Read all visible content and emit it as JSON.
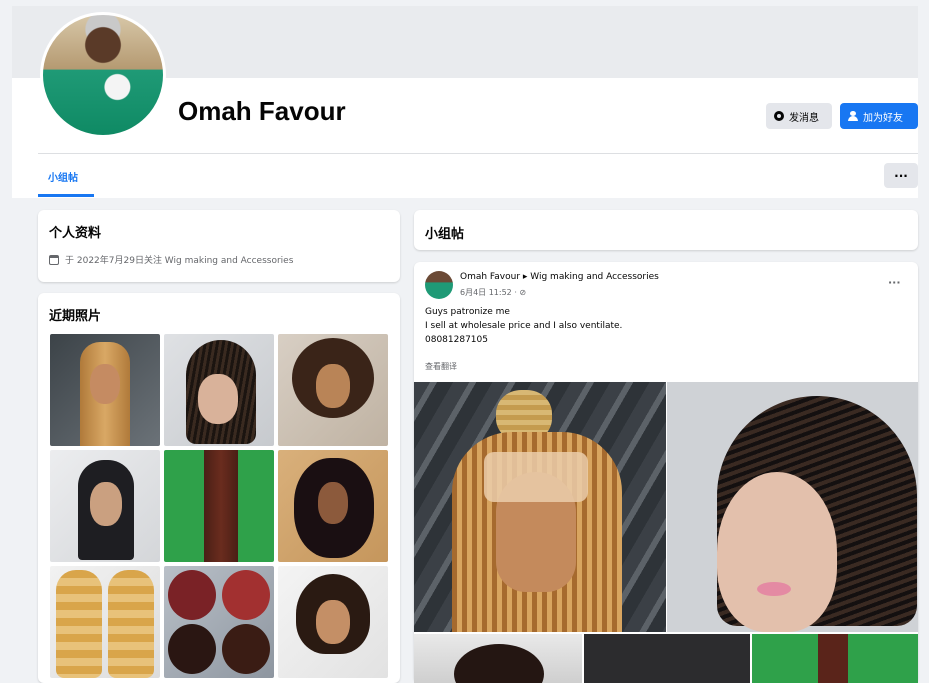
{
  "profile": {
    "name": "Omah Favour",
    "message_label": "发消息",
    "add_friend_label": "加为好友"
  },
  "tabs": [
    {
      "label": "小组帖",
      "active": true
    }
  ],
  "more_label": "···",
  "about": {
    "title": "个人资料",
    "joined_text": "于 2022年7月29日关注 Wig making and Accessories"
  },
  "photos": {
    "title": "近期照片"
  },
  "group_posts": {
    "title": "小组帖",
    "post": {
      "author": "Omah Favour ▸ Wig making and Accessories",
      "time": "6月4日 11:52 · ⊘",
      "more_label": "···",
      "lines": [
        "Guys patronize me",
        "I sell at wholesale price and I also ventilate.",
        "08081287105"
      ],
      "see_translation": "查看翻译"
    }
  },
  "colors": {
    "accent": "#1877f2",
    "page_bg": "#f0f2f5",
    "card_bg": "#ffffff",
    "secondary_text": "#65676b"
  }
}
